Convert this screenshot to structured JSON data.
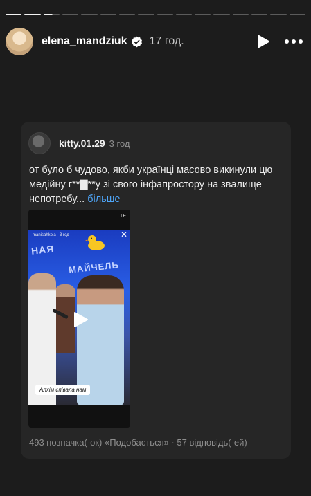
{
  "story": {
    "progress_segments": 16,
    "progress_completed": 2,
    "progress_current_fraction": 0.55
  },
  "header": {
    "username": "elena_mandziuk",
    "time": "17 год.",
    "icons": [
      "verified-badge-icon",
      "play-icon",
      "more-icon"
    ]
  },
  "card": {
    "username": "kitty.01.29",
    "time": "3 год",
    "caption": "от було б чудово, якби українці масово викинули цю медійну г**▇**у зі свого інфапростору на звалище непотребу...",
    "more_label": "більше",
    "video": {
      "status_text": "LTE",
      "overlay_handle": "manisahkola · 3 год",
      "sign_text_1": "НАЯ",
      "sign_text_2": "МАЙЧЕЛЬ",
      "caption_sticker": "Алхім співала нам",
      "icons": [
        "duck-icon",
        "close-icon",
        "play-icon"
      ]
    },
    "stats": "493 позначка(-ок) «Подобається» · 57 відповідь(-ей)"
  },
  "colors": {
    "background": "#1c1c1c",
    "card": "#262626",
    "link": "#4ea4f6",
    "muted": "#8e8e8e"
  }
}
